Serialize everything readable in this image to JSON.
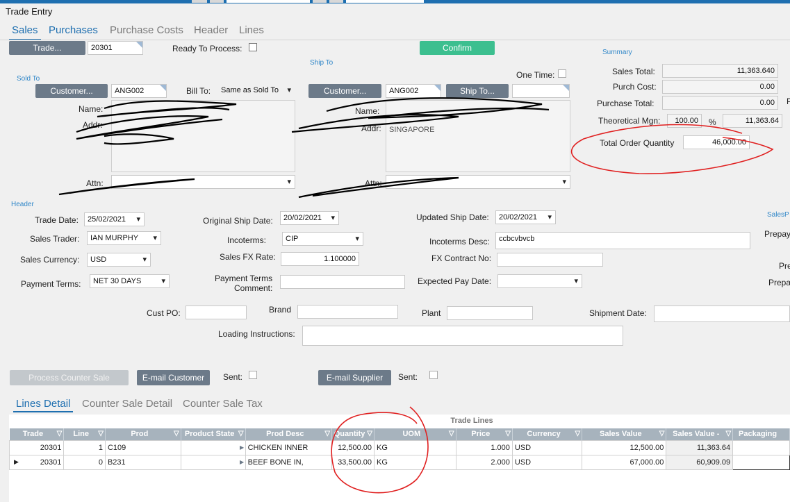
{
  "window": {
    "title": "Trade Entry"
  },
  "tabs": [
    "Sales",
    "Purchases",
    "Purchase Costs",
    "Header",
    "Lines"
  ],
  "trade": {
    "button_label": "Trade...",
    "number": "20301",
    "ready_label": "Ready To Process:",
    "confirm_label": "Confirm"
  },
  "sold_to": {
    "section_label": "Sold To",
    "customer_button": "Customer...",
    "customer_code": "ANG002",
    "bill_to_label": "Bill To:",
    "bill_to_value": "Same as Sold To",
    "name_label": "Name:",
    "addr_label": "Addr:",
    "name_value": "",
    "addr_line1": "",
    "addr_line2": "",
    "attn_label": "Attn:",
    "attn_value": ""
  },
  "ship_to": {
    "section_label": "Ship To",
    "one_time_label": "One Time:",
    "customer_button": "Customer...",
    "customer_code": "ANG002",
    "ship_to_button": "Ship To...",
    "name_label": "Name:",
    "addr_label": "Addr:",
    "addr_line1": "",
    "addr_line2": "SINGAPORE",
    "attn_label": "Attn:",
    "attn_value": ""
  },
  "summary": {
    "section_label": "Summary",
    "sales_total_label": "Sales Total:",
    "sales_total": "11,363.640",
    "purch_cost_label": "Purch Cost:",
    "purch_cost": "0.00",
    "purchase_total_label": "Purchase Total:",
    "purchase_total": "0.00",
    "theo_margin_label": "Theoretical Mgn:",
    "theo_margin_pct": "100.00",
    "pct_symbol": "%",
    "theo_margin_value": "11,363.64",
    "total_qty_label": "Total Order Quantity",
    "total_qty": "46,000.00",
    "right_edge_label": "P"
  },
  "header": {
    "section_label": "Header",
    "trade_date_label": "Trade Date:",
    "trade_date": "25/02/2021",
    "orig_ship_label": "Original Ship Date:",
    "orig_ship": "20/02/2021",
    "updated_ship_label": "Updated Ship Date:",
    "updated_ship": "20/02/2021",
    "sales_trader_label": "Sales Trader:",
    "sales_trader": "IAN MURPHY",
    "incoterms_label": "Incoterms:",
    "incoterms": "CIP",
    "incoterms_desc_label": "Incoterms Desc:",
    "incoterms_desc": "ccbcvbvcb",
    "currency_label": "Sales Currency:",
    "currency": "USD",
    "fx_rate_label": "Sales FX Rate:",
    "fx_rate": "1.100000",
    "fx_contract_label": "FX Contract No:",
    "fx_contract": "",
    "payment_terms_label": "Payment Terms:",
    "payment_terms": "NET 30 DAYS",
    "pt_comment_label1": "Payment Terms",
    "pt_comment_label2": "Comment:",
    "pt_comment": "",
    "expected_pay_label": "Expected Pay Date:",
    "expected_pay": "",
    "cust_po_label": "Cust PO:",
    "brand_label": "Brand",
    "plant_label": "Plant",
    "shipment_date_label": "Shipment Date:",
    "loading_label": "Loading Instructions:",
    "right_section_label": "SalesP",
    "right_prepay1": "Prepay",
    "right_pre": "Pre",
    "right_prepay2": "Prepa"
  },
  "actions": {
    "process_counter": "Process Counter Sale",
    "email_customer": "E-mail Customer",
    "sent1_label": "Sent:",
    "email_supplier": "E-mail Supplier",
    "sent2_label": "Sent:"
  },
  "bottom_tabs": [
    "Lines Detail",
    "Counter Sale Detail",
    "Counter Sale Tax"
  ],
  "grid": {
    "caption": "Trade Lines",
    "columns": [
      "Trade",
      "Line",
      "Prod",
      "Product State",
      "Prod Desc",
      "Quantity",
      "UOM",
      "Price",
      "Currency",
      "Sales Value",
      "Sales Value -",
      "Packaging"
    ],
    "rows": [
      [
        "20301",
        "1",
        "C109",
        "",
        "CHICKEN INNER",
        "12,500.00",
        "KG",
        "1.000",
        "USD",
        "12,500.00",
        "11,363.64",
        ""
      ],
      [
        "20301",
        "0",
        "B231",
        "",
        "BEEF BONE IN,",
        "33,500.00",
        "KG",
        "2.000",
        "USD",
        "67,000.00",
        "60,909.09",
        ""
      ]
    ]
  }
}
